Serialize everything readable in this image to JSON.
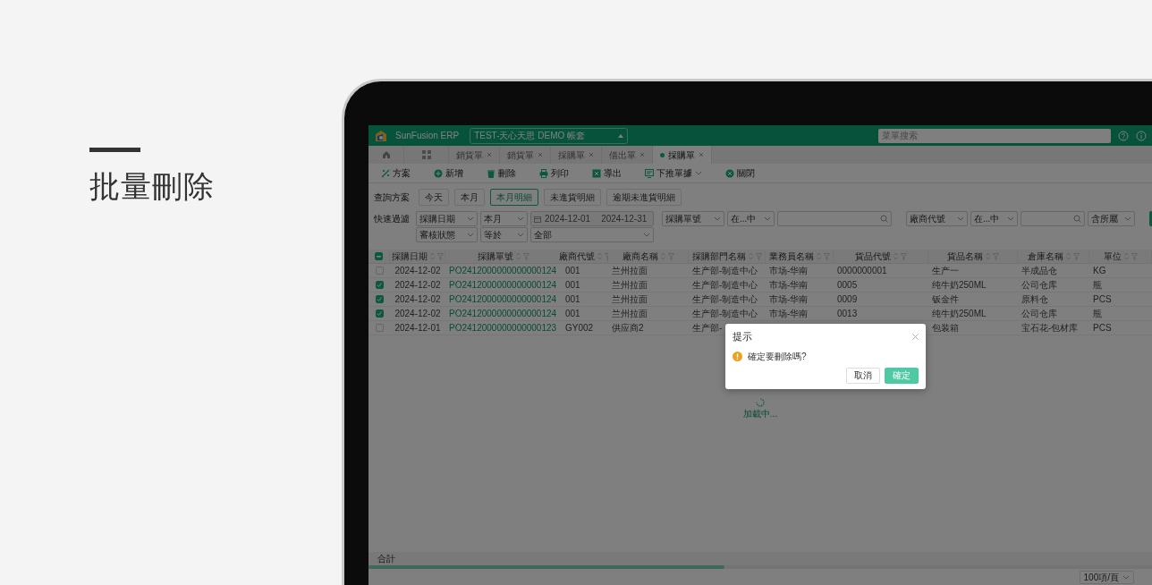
{
  "slide": {
    "heading": "批量刪除"
  },
  "app": {
    "header": {
      "logo_text": "SunFusion ERP",
      "account": "TEST-天心天思 DEMO 帳套",
      "search_placeholder": "菜單搜索"
    },
    "tabs": [
      {
        "label": "銷貨單",
        "selected": false
      },
      {
        "label": "銷貨單",
        "selected": false
      },
      {
        "label": "採購單",
        "selected": false
      },
      {
        "label": "借出單",
        "selected": false
      },
      {
        "label": "採購單",
        "selected": true
      }
    ],
    "toolbar": [
      {
        "label": "方案",
        "kind": "plan"
      },
      {
        "label": "新增",
        "kind": "add"
      },
      {
        "label": "刪除",
        "kind": "delete"
      },
      {
        "label": "列印",
        "kind": "print"
      },
      {
        "label": "導出",
        "kind": "export"
      },
      {
        "label": "下推單據",
        "kind": "push"
      },
      {
        "label": "關閉",
        "kind": "close"
      }
    ],
    "query_plans": {
      "label": "查詢方案",
      "options": [
        {
          "label": "今天",
          "selected": false
        },
        {
          "label": "本月",
          "selected": false
        },
        {
          "label": "本月明細",
          "selected": true
        },
        {
          "label": "未進貨明細",
          "selected": false
        },
        {
          "label": "逾期未進貨明細",
          "selected": false
        }
      ]
    },
    "quick_filter": {
      "label": "快速過濾",
      "rows": [
        [
          {
            "kind": "select",
            "value": "採購日期"
          },
          {
            "kind": "select",
            "value": "本月"
          },
          {
            "kind": "daterange",
            "from": "2024-12-01",
            "to": "2024-12-31"
          },
          {
            "kind": "select",
            "value": "採購單號"
          },
          {
            "kind": "select",
            "value": "在...中"
          },
          {
            "kind": "search"
          },
          {
            "kind": "select",
            "value": "廠商代號"
          },
          {
            "kind": "select",
            "value": "在...中"
          },
          {
            "kind": "search"
          },
          {
            "kind": "select",
            "value": "含所屬"
          },
          {
            "kind": "button"
          }
        ],
        [
          {
            "kind": "select",
            "value": "審核狀態"
          },
          {
            "kind": "select",
            "value": "等於"
          },
          {
            "kind": "select",
            "value": "全部"
          }
        ]
      ]
    },
    "table": {
      "all_indeterminate": true,
      "columns": [
        "採購日期",
        "採購單號",
        "廠商代號",
        "廠商名稱",
        "採購部門名稱",
        "業務員名稱",
        "貨品代號",
        "貨品名稱",
        "倉庫名稱",
        "單位"
      ],
      "rows": [
        {
          "selected": false,
          "cells": [
            "2024-12-02",
            "PO2412000000000000124",
            "001",
            "兰州拉面",
            "生产部-制造中心",
            "市场-华南",
            "0000000001",
            "生产一",
            "半成品仓",
            "KG"
          ]
        },
        {
          "selected": true,
          "cells": [
            "2024-12-02",
            "PO2412000000000000124",
            "001",
            "兰州拉面",
            "生产部-制造中心",
            "市场-华南",
            "0005",
            "纯牛奶250ML",
            "公司仓库",
            "瓶"
          ]
        },
        {
          "selected": true,
          "cells": [
            "2024-12-02",
            "PO2412000000000000124",
            "001",
            "兰州拉面",
            "生产部-制造中心",
            "市场-华南",
            "0009",
            "钣金件",
            "原料仓",
            "PCS"
          ]
        },
        {
          "selected": true,
          "cells": [
            "2024-12-02",
            "PO2412000000000000124",
            "001",
            "兰州拉面",
            "生产部-制造中心",
            "市场-华南",
            "0013",
            "纯牛奶250ML",
            "公司仓库",
            "瓶"
          ]
        },
        {
          "selected": false,
          "cells": [
            "2024-12-01",
            "PO2412000000000000123",
            "GY002",
            "供应商2",
            "生产部-",
            null,
            null,
            "包装箱",
            "宝石花-包材库",
            "PCS"
          ]
        }
      ],
      "loading": "加載中...",
      "total_label": "合計",
      "page_size": "100項/頁"
    },
    "dialog": {
      "title": "提示",
      "message": "確定要刪除嗎?",
      "buttons": [
        {
          "label": "取消",
          "kind": "secondary"
        },
        {
          "label": "確定",
          "kind": "primary"
        }
      ]
    }
  }
}
